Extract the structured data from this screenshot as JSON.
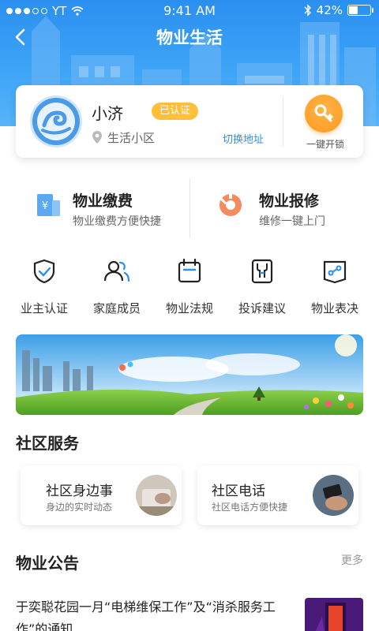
{
  "status_bar": {
    "carrier": "YT",
    "time": "9:41 AM",
    "battery": "42%",
    "battery_level": 0.42
  },
  "nav": {
    "title": "物业生活"
  },
  "profile": {
    "name": "小济",
    "badge": "已认证",
    "community": "生活小区",
    "switch_address": "切换地址",
    "unlock_label": "一键开锁"
  },
  "main_services": [
    {
      "title": "物业缴费",
      "subtitle": "物业缴费方便快捷",
      "icon": "bill-icon"
    },
    {
      "title": "物业报修",
      "subtitle": "维修一键上门",
      "icon": "repair-icon"
    }
  ],
  "grid": [
    {
      "label": "业主认证",
      "icon": "shield-check-icon"
    },
    {
      "label": "家庭成员",
      "icon": "family-icon"
    },
    {
      "label": "物业法规",
      "icon": "calendar-icon"
    },
    {
      "label": "投诉建议",
      "icon": "wrench-icon"
    },
    {
      "label": "物业表决",
      "icon": "vote-icon"
    }
  ],
  "community_services": {
    "title": "社区服务",
    "items": [
      {
        "title": "社区身边事",
        "subtitle": "身边的实时动态"
      },
      {
        "title": "社区电话",
        "subtitle": "社区电话方便快捷"
      }
    ]
  },
  "notices": {
    "title": "物业公告",
    "more": "更多",
    "items": [
      {
        "text": "于奕聪花园一月“电梯维保工作”及“消杀服务工作”的通知"
      }
    ]
  },
  "colors": {
    "primary": "#2a8ff0",
    "badge": "#ffbf3a",
    "unlock": "#ff9a1f",
    "repair": "#f06a3c"
  }
}
